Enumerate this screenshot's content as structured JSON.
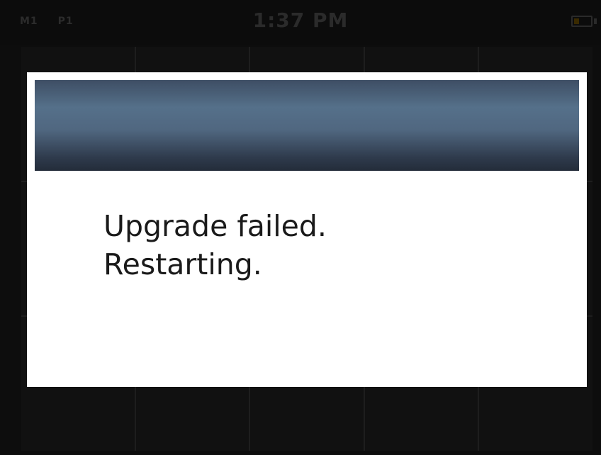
{
  "status_bar": {
    "left_labels": [
      "M1",
      "P1"
    ],
    "time": "1:37 PM",
    "battery_level": 0.3
  },
  "dialog": {
    "message_lines": [
      "Upgrade failed.",
      "Restarting."
    ]
  }
}
